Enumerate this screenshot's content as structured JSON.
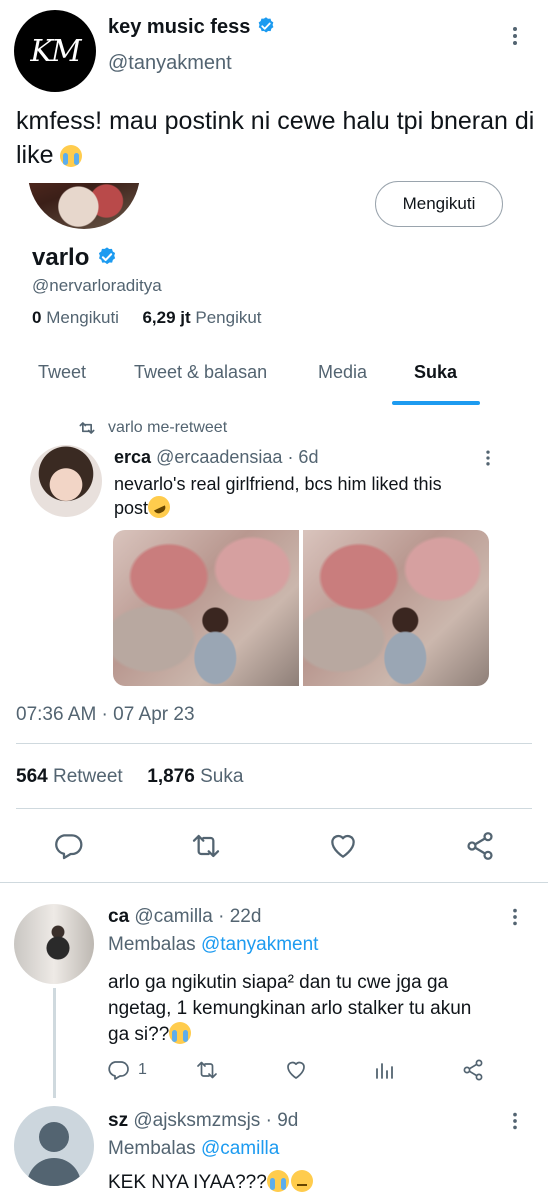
{
  "tweet": {
    "display_name": "key music fess",
    "handle": "@tanyakment",
    "logo_text": "KM",
    "text": "kmfess! mau postink ni cewe halu tpi bneran di like",
    "timestamp": "07:36 AM · 07 Apr 23",
    "retweet_count": "564",
    "retweet_label": "Retweet",
    "like_count": "1,876",
    "like_label": "Suka"
  },
  "embedded_profile": {
    "name": "varlo",
    "handle": "@nervarloraditya",
    "following_count": "0",
    "following_label": "Mengikuti",
    "followers_count": "6,29 jt",
    "followers_label": "Pengikut",
    "follow_button": "Mengikuti",
    "tabs": [
      "Tweet",
      "Tweet & balasan",
      "Media",
      "Suka"
    ],
    "active_tab": "Suka",
    "retweet_context": "varlo me-retweet",
    "inner_tweet": {
      "name": "erca",
      "handle": "@ercaadensiaa",
      "age": "· 6d",
      "text_line1": "nevarlo's real girlfriend, bcs him liked this",
      "text_line2": "post"
    }
  },
  "replies": [
    {
      "name": "ca",
      "handle": "@camilla",
      "age": "· 22d",
      "replying_label": "Membalas",
      "replying_to": "@tanyakment",
      "text_line1": "arlo ga ngikutin siapa² dan tu cwe jga ga",
      "text_line2": "ngetag, 1 kemungkinan arlo stalker tu akun",
      "text_line3": "ga si??",
      "reply_count": "1"
    },
    {
      "name": "sz",
      "handle": "@ajsksmzmsjs",
      "age": "· 9d",
      "replying_label": "Membalas",
      "replying_to": "@camilla",
      "text": "KEK NYA IYAA???"
    }
  ],
  "colors": {
    "accent": "#1d9bf0",
    "muted": "#536471",
    "divider": "#cfd9de"
  },
  "icons": [
    "verified-badge-icon",
    "more-options-icon",
    "retweet-icon",
    "reply-icon",
    "like-icon",
    "share-icon",
    "analytics-icon",
    "loudly-crying-emoji",
    "rofl-emoji",
    "pensive-emoji"
  ]
}
